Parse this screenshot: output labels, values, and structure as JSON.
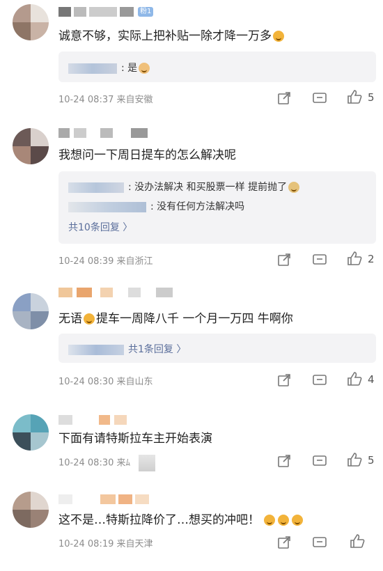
{
  "colors": {
    "accent_link": "#5a6e9b",
    "meta": "#8c8c8c",
    "reply_bg": "#f3f3f5"
  },
  "comments": [
    {
      "text": "诚意不够，实际上把补贴一除才降一万多",
      "emoji": "grinning-cat-emoji",
      "badge": "粉1",
      "replies": [
        {
          "text": ": 是",
          "emoji": "cat-emoji"
        }
      ],
      "more": "",
      "meta": "10-24 08:37  来自安徽",
      "likes": "5"
    },
    {
      "text": "我想问一下周日提车的怎么解决呢",
      "replies": [
        {
          "text": ": 没办法解决 和买股票一样 提前抛了",
          "emoji": "bowl-emoji"
        },
        {
          "text": ": 没有任何方法解决吗"
        }
      ],
      "more": "共10条回复 〉",
      "meta": "10-24 08:39  来自浙江",
      "likes": "2"
    },
    {
      "text_before": "无语",
      "text_after": "提车一周降八千 一个月一万四 牛啊你",
      "emoji": "smile-emoji",
      "more": "共1条回复 〉",
      "meta": "10-24 08:30  来自山东",
      "likes": "4"
    },
    {
      "text": "下面有请特斯拉车主开始表演",
      "meta": "10-24 08:30  来ﾑ",
      "likes": "5"
    },
    {
      "text": "这不是…特斯拉降价了…想买的冲吧！",
      "emoji": "cry-laugh-emoji",
      "meta": "10-24 08:19  来自天津",
      "likes": ""
    }
  ]
}
